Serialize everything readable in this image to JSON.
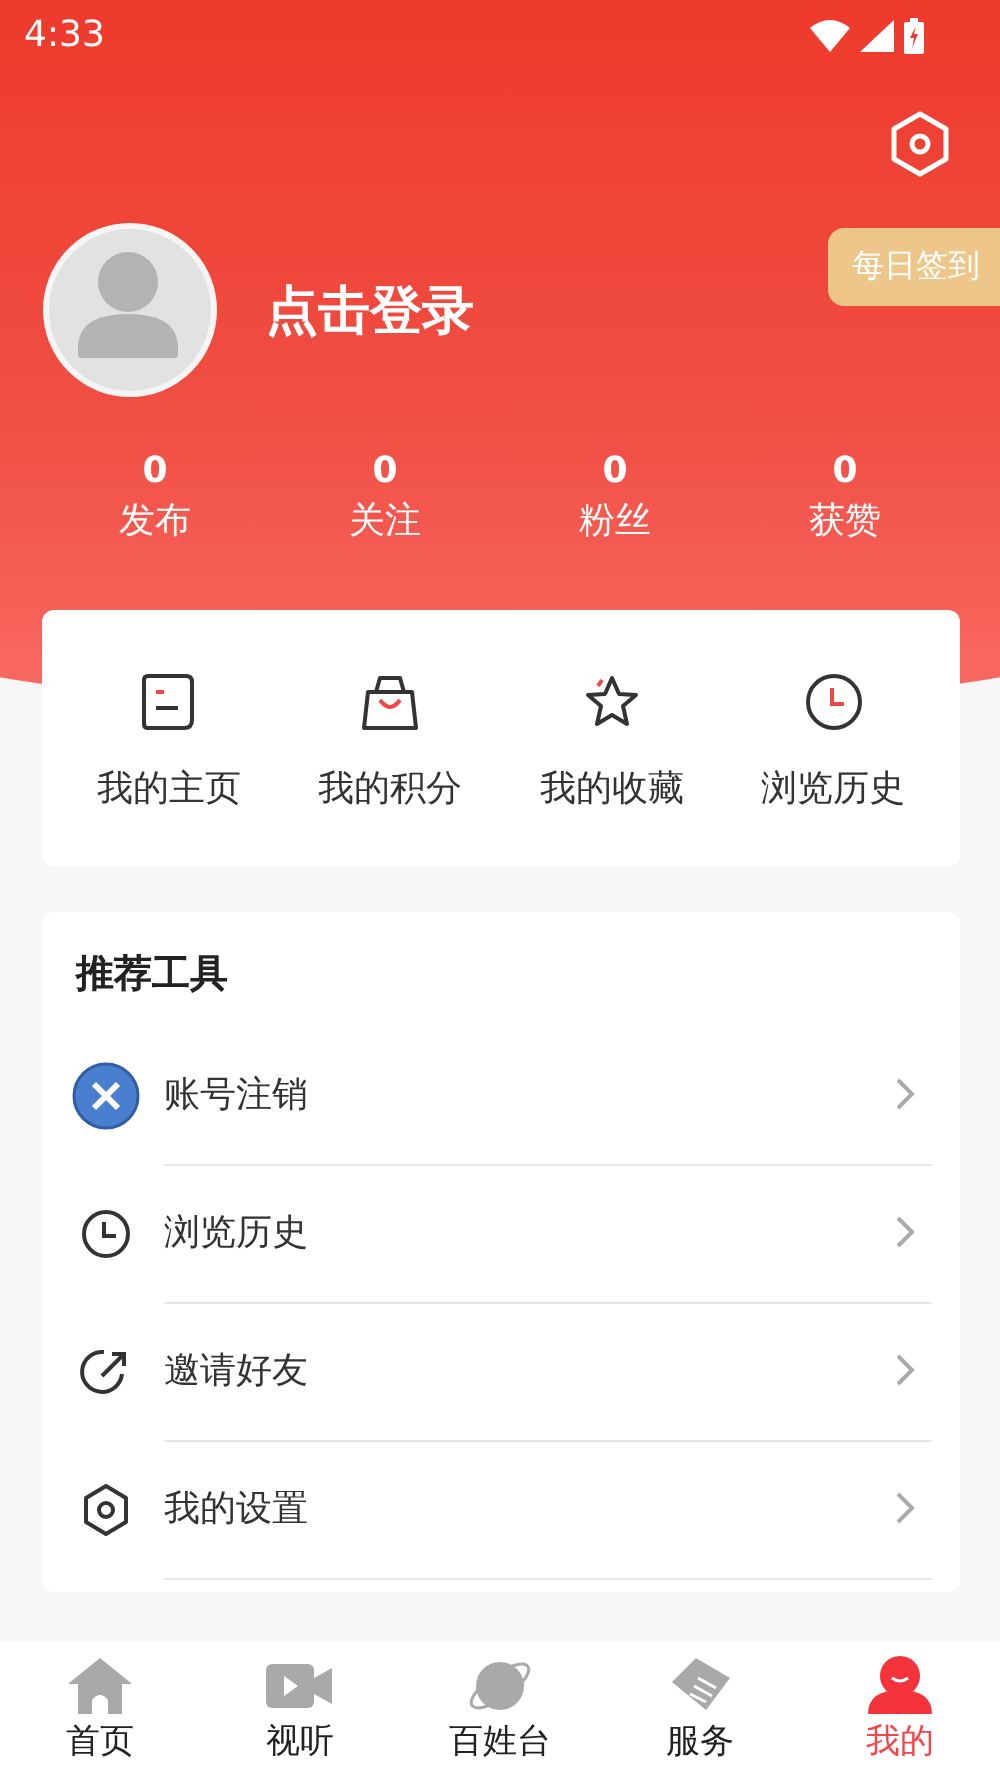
{
  "status_bar": {
    "time": "4:33"
  },
  "header": {
    "login_text": "点击登录",
    "checkin_button": "每日签到"
  },
  "stats": [
    {
      "value": "0",
      "label": "发布"
    },
    {
      "value": "0",
      "label": "关注"
    },
    {
      "value": "0",
      "label": "粉丝"
    },
    {
      "value": "0",
      "label": "获赞"
    }
  ],
  "shortcuts": [
    {
      "kind": "page",
      "label": "我的主页"
    },
    {
      "kind": "bag",
      "label": "我的积分"
    },
    {
      "kind": "star",
      "label": "我的收藏"
    },
    {
      "kind": "clock",
      "label": "浏览历史"
    }
  ],
  "tools": {
    "title": "推荐工具",
    "items": [
      {
        "kind": "cancel",
        "label": "账号注销"
      },
      {
        "kind": "clock",
        "label": "浏览历史"
      },
      {
        "kind": "share",
        "label": "邀请好友"
      },
      {
        "kind": "settings",
        "label": "我的设置"
      }
    ]
  },
  "bottom_nav": [
    {
      "kind": "home",
      "label": "首页",
      "selected": false
    },
    {
      "kind": "video",
      "label": "视听",
      "selected": false
    },
    {
      "kind": "planet",
      "label": "百姓台",
      "selected": false
    },
    {
      "kind": "service",
      "label": "服务",
      "selected": false
    },
    {
      "kind": "me",
      "label": "我的",
      "selected": true
    }
  ]
}
